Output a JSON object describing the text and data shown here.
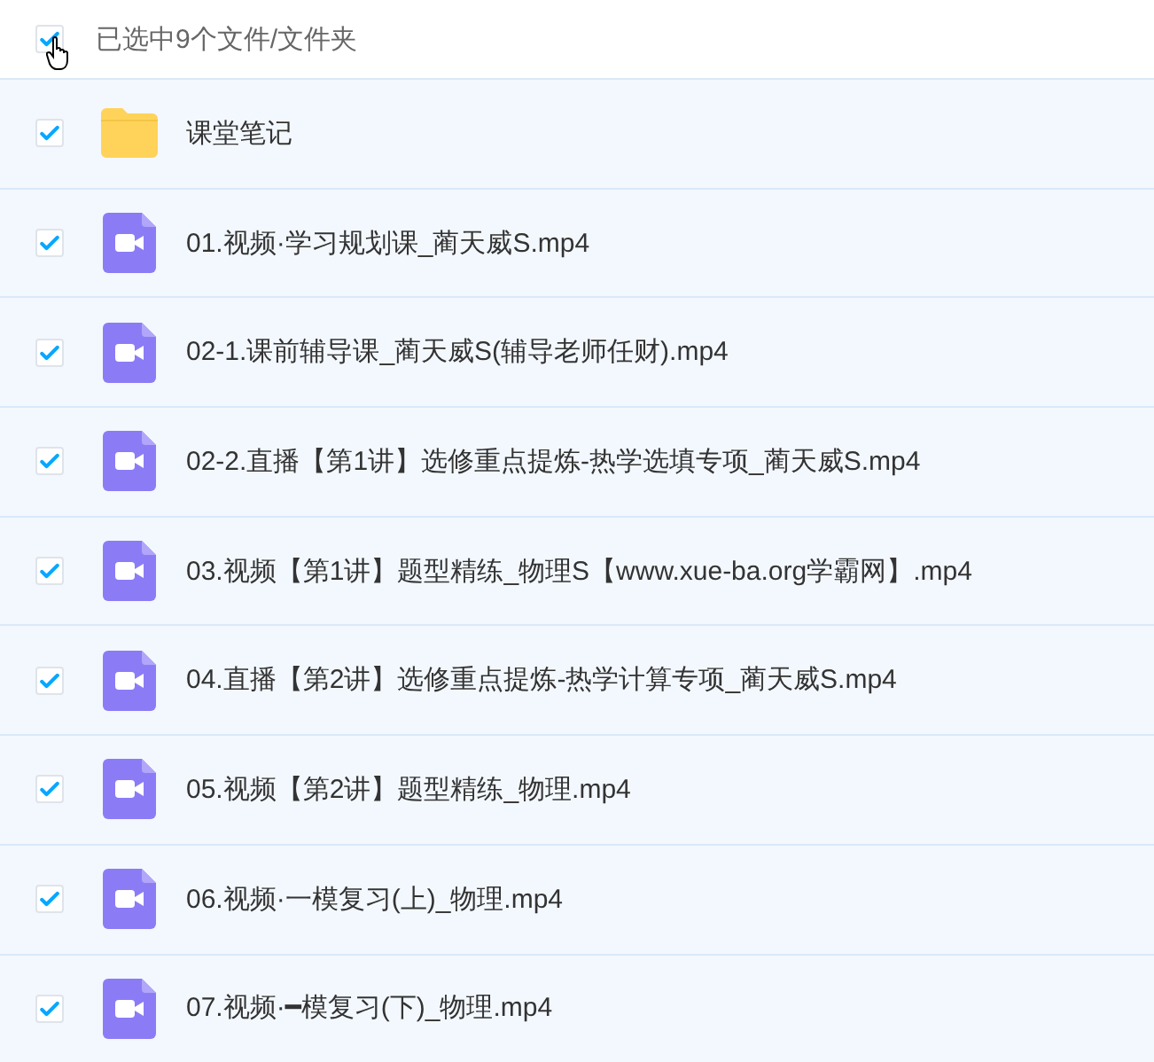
{
  "header": {
    "checked": true,
    "label": "已选中9个文件/文件夹"
  },
  "files": [
    {
      "kind": "folder",
      "name": "课堂笔记",
      "checked": true
    },
    {
      "kind": "video",
      "name": "01.视频·学习规划课_蔺天威S.mp4",
      "checked": true
    },
    {
      "kind": "video",
      "name": "02-1.课前辅导课_蔺天威S(辅导老师任财).mp4",
      "checked": true
    },
    {
      "kind": "video",
      "name": "02-2.直播【第1讲】选修重点提炼-热学选填专项_蔺天威S.mp4",
      "checked": true
    },
    {
      "kind": "video",
      "name": "03.视频【第1讲】题型精练_物理S【www.xue-ba.org学霸网】.mp4",
      "checked": true
    },
    {
      "kind": "video",
      "name": "04.直播【第2讲】选修重点提炼-热学计算专项_蔺天威S.mp4",
      "checked": true
    },
    {
      "kind": "video",
      "name": "05.视频【第2讲】题型精练_物理.mp4",
      "checked": true
    },
    {
      "kind": "video",
      "name": "06.视频·一模复习(上)_物理.mp4",
      "checked": true
    },
    {
      "kind": "video",
      "name": "07.视频·━模复习(下)_物理.mp4",
      "checked": true
    }
  ]
}
